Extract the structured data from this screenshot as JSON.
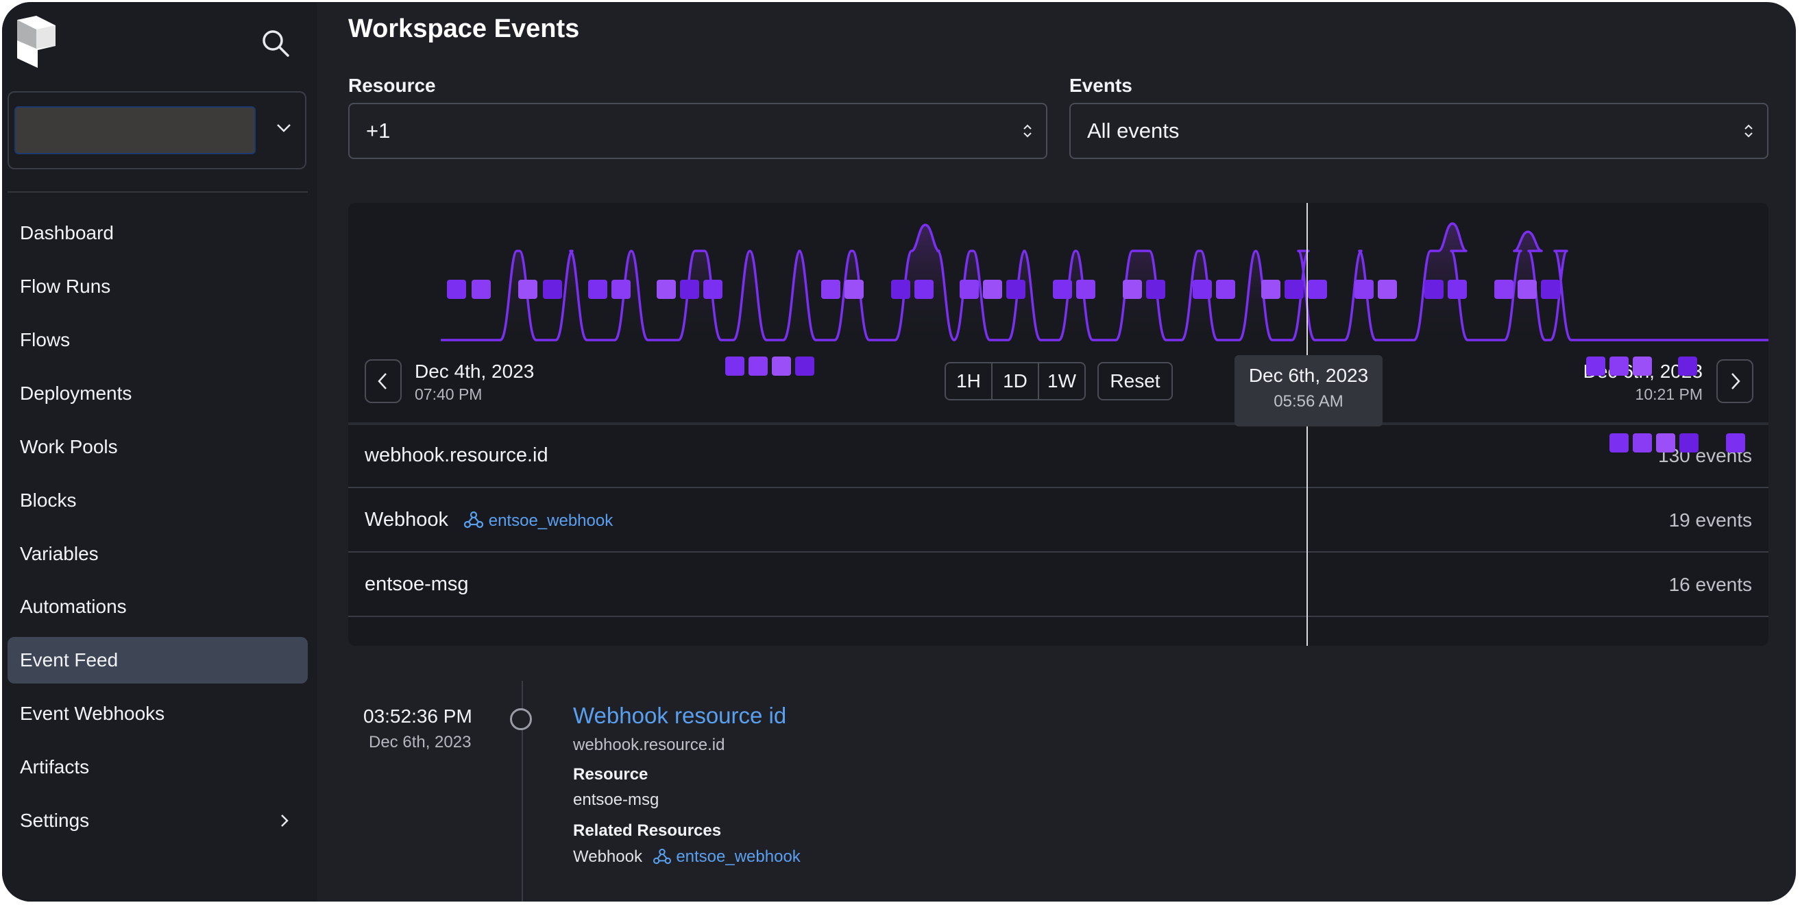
{
  "sidebar": {
    "logo": "prefect-logo-icon",
    "search_icon": "search-icon",
    "items": [
      {
        "label": "Dashboard"
      },
      {
        "label": "Flow Runs"
      },
      {
        "label": "Flows"
      },
      {
        "label": "Deployments"
      },
      {
        "label": "Work Pools"
      },
      {
        "label": "Blocks"
      },
      {
        "label": "Variables"
      },
      {
        "label": "Automations"
      },
      {
        "label": "Event Feed",
        "active": true
      },
      {
        "label": "Event Webhooks"
      },
      {
        "label": "Artifacts"
      },
      {
        "label": "Settings"
      }
    ]
  },
  "page": {
    "title": "Workspace Events"
  },
  "filters": {
    "resource": {
      "label": "Resource",
      "value": "+1"
    },
    "events": {
      "label": "Events",
      "value": "All events"
    }
  },
  "timeline": {
    "start": {
      "date": "Dec 4th, 2023",
      "time": "07:40 PM"
    },
    "end": {
      "date": "Dec 6th, 2023",
      "time": "10:21 PM"
    },
    "zoom": [
      "1H",
      "1D",
      "1W"
    ],
    "reset_label": "Reset",
    "cursor": {
      "date": "Dec 6th, 2023",
      "time": "05:56 AM"
    },
    "accent_color": "#7b2ff0",
    "rows": [
      {
        "label": "webhook.resource.id",
        "count": "130 events"
      },
      {
        "label": "Webhook",
        "link": "entsoe_webhook",
        "count": "19 events"
      },
      {
        "label": "entsoe-msg",
        "count": "16 events"
      }
    ]
  },
  "feed": [
    {
      "time": "03:52:36 PM",
      "date": "Dec 6th, 2023",
      "title": "Webhook resource id",
      "event": "webhook.resource.id",
      "resource_label": "Resource",
      "resource": "entsoe-msg",
      "related_label": "Related Resources",
      "related_type": "Webhook",
      "related_link": "entsoe_webhook"
    }
  ]
}
